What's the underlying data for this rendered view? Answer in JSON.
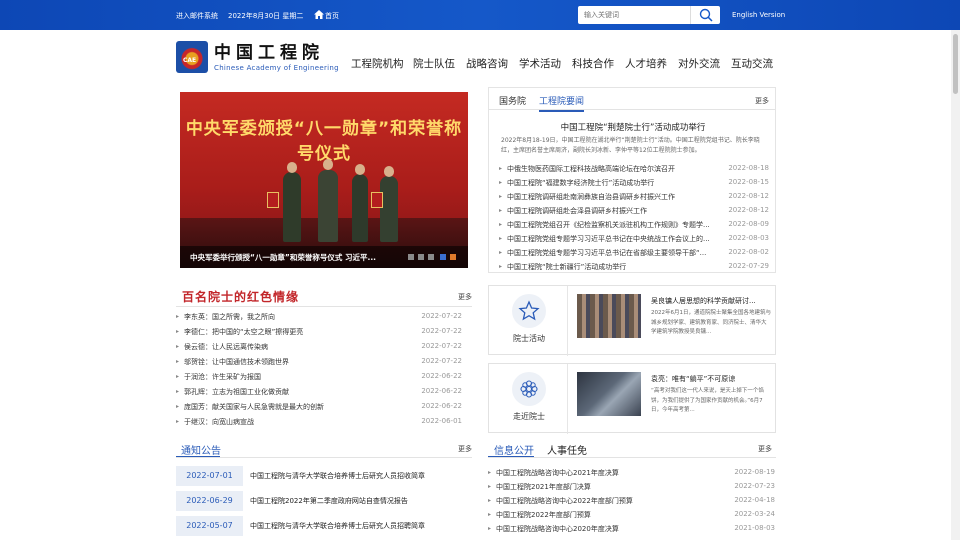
{
  "topbar": {
    "mail": "进入邮件系统",
    "date": "2022年8月30日  星期二",
    "home": "首页",
    "search_placeholder": "输入关键词",
    "english": "English Version"
  },
  "logo": {
    "cn": "中国工程院",
    "en": "Chinese Academy of Engineering",
    "badge": "CAE"
  },
  "nav": [
    "工程院机构",
    "院士队伍",
    "战略咨询",
    "学术活动",
    "科技合作",
    "人才培养",
    "对外交流",
    "互动交流"
  ],
  "slideshow": {
    "banner": "中央军委颁授“八一勋章”和荣誉称号仪式",
    "caption": "中央军委举行颁授“八一勋章”和荣誉称号仪式 习近平...",
    "dot_colors": [
      "#8a8a8a",
      "#8a8a8a",
      "#8a8a8a",
      "#3b6fd0",
      "#e07a2c"
    ]
  },
  "news_panel": {
    "tabs": [
      "国务院",
      "工程院要闻"
    ],
    "more": "更多",
    "headline": "中国工程院“荆楚院士行”活动成功举行",
    "summary": "2022年8月18-19日，中国工程院在湖北举行“荆楚院士行”活动。中国工程院党组书记、院长李晓红，主席团名誉主席周济，副院长刘冰新、李仲平等12位工程院院士参加。",
    "items": [
      {
        "title": "中俄生物医药国际工程科技战略高端论坛在哈尔滨召开",
        "date": "2022-08-18"
      },
      {
        "title": "中国工程院“福建数字经济院士行”活动成功举行",
        "date": "2022-08-15"
      },
      {
        "title": "中国工程院调研组赴南涧彝族自治县调研乡村振兴工作",
        "date": "2022-08-12"
      },
      {
        "title": "中国工程院调研组赴会泽县调研乡村振兴工作",
        "date": "2022-08-12"
      },
      {
        "title": "中国工程院党组召开《纪检监察机关派驻机构工作规则》专题学...",
        "date": "2022-08-09"
      },
      {
        "title": "中国工程院党组专题学习习近平总书记在中央统战工作会议上的...",
        "date": "2022-08-03"
      },
      {
        "title": "中国工程院党组专题学习习近平总书记在省部级主要领导干部“...",
        "date": "2022-08-02"
      },
      {
        "title": "中国工程院“院士新疆行”活动成功举行",
        "date": "2022-07-29"
      }
    ]
  },
  "red_section": {
    "title": "百名院士的红色情缘",
    "more": "更多",
    "items": [
      {
        "title": "李东英：国之所需，我之所向",
        "date": "2022-07-22"
      },
      {
        "title": "李德仁：把中国的“太空之眼”擦得更亮",
        "date": "2022-07-22"
      },
      {
        "title": "侯云德：让人民远离传染病",
        "date": "2022-07-22"
      },
      {
        "title": "邬贺铨：让中国通信技术领跑世界",
        "date": "2022-07-22"
      },
      {
        "title": "于润沧：许生采矿为报国",
        "date": "2022-06-22"
      },
      {
        "title": "郭孔辉：立志为祖国工业化做贡献",
        "date": "2022-06-22"
      },
      {
        "title": "庞国芳：献关国家与人民急需就是最大的创新",
        "date": "2022-06-22"
      },
      {
        "title": "于继汉：向宽山病宣战",
        "date": "2022-06-01"
      }
    ]
  },
  "cards": [
    {
      "label": "院士活动",
      "title": "吴良镛人居思想的科学贡献研讨...",
      "desc": "2022年6月1日，通道院院士聚集全国各地建筑与城乡规划学家、建筑教育家、同济院士、清华大学建筑学院教授吴良镛..."
    },
    {
      "label": "走近院士",
      "title": "袁亮：唯有“躺平”不可原谅",
      "desc": "“高考对我们这一代人来说，是天上掉下一个馅饼，为我们提供了为国家作贡献的机会。”6月7日，今年高考第..."
    }
  ],
  "notices": {
    "title": "通知公告",
    "more": "更多",
    "items": [
      {
        "date": "2022-07-01",
        "title": "中国工程院与清华大学联合培养博士后研究人员招收简章"
      },
      {
        "date": "2022-06-29",
        "title": "中国工程院2022年第二季度政府网站自查情况报告"
      },
      {
        "date": "2022-05-07",
        "title": "中国工程院与清华大学联合培养博士后研究人员招聘简章"
      }
    ]
  },
  "info": {
    "tabs": [
      "信息公开",
      "人事任免"
    ],
    "more": "更多",
    "items": [
      {
        "title": "中国工程院战略咨询中心2021年度决算",
        "date": "2022-08-19"
      },
      {
        "title": "中国工程院2021年度部门决算",
        "date": "2022-07-23"
      },
      {
        "title": "中国工程院战略咨询中心2022年度部门预算",
        "date": "2022-04-18"
      },
      {
        "title": "中国工程院2022年度部门预算",
        "date": "2022-03-24"
      },
      {
        "title": "中国工程院战略咨询中心2020年度决算",
        "date": "2021-08-03"
      }
    ]
  },
  "colors": {
    "brand_blue": "#1558c9",
    "accent_red": "#c2262a",
    "link_blue": "#2a5bb8"
  }
}
